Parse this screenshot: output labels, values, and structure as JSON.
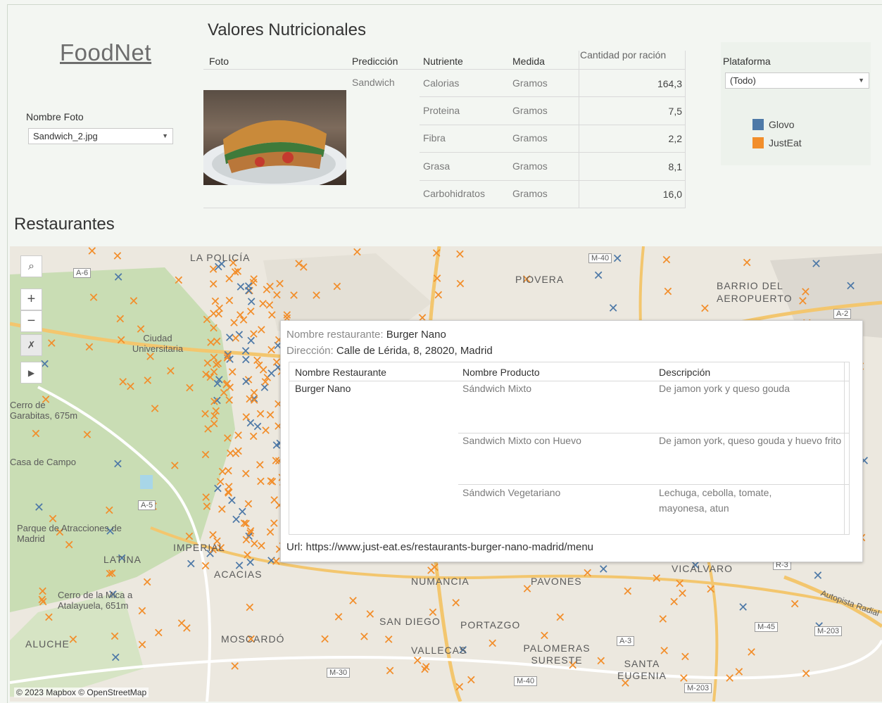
{
  "app": {
    "logo": "FoodNet"
  },
  "filters": {
    "photo_label": "Nombre Foto",
    "photo_value": "Sandwich_2.jpg",
    "platform_label": "Plataforma",
    "platform_value": "(Todo)"
  },
  "nutrition": {
    "title": "Valores Nutricionales",
    "headers": {
      "foto": "Foto",
      "prediccion": "Predicción",
      "nutriente": "Nutriente",
      "medida": "Medida",
      "cantidad": "Cantidad por ración"
    },
    "prediction": "Sandwich",
    "rows": [
      {
        "nutrient": "Calorias",
        "measure": "Gramos",
        "amount": "164,3"
      },
      {
        "nutrient": "Proteina",
        "measure": "Gramos",
        "amount": "7,5"
      },
      {
        "nutrient": "Fibra",
        "measure": "Gramos",
        "amount": "2,2"
      },
      {
        "nutrient": "Grasa",
        "measure": "Gramos",
        "amount": "8,1"
      },
      {
        "nutrient": "Carbohidratos",
        "measure": "Gramos",
        "amount": "16,0"
      }
    ]
  },
  "legend": {
    "items": [
      {
        "label": "Glovo",
        "color": "#4e79a7"
      },
      {
        "label": "JustEat",
        "color": "#f28e2b"
      }
    ]
  },
  "map": {
    "title": "Restaurantes",
    "attribution": "© 2023 Mapbox © OpenStreetMap",
    "labels": [
      "LA POLICÍA",
      "PIOVERA",
      "BARRIO DEL AEROPUERTO",
      "Ciudad Universitaria",
      "Cerro de Garabitas, 675m",
      "Casa de Campo",
      "Parque de Atracciones de Madrid",
      "LATINA",
      "IMPERIAL",
      "ACACIAS",
      "NUMANCIA",
      "PAVONES",
      "VICÁLVARO",
      "Cerro de la Mica a Atalayuela, 651m",
      "SAN DIEGO",
      "PORTAZGO",
      "ALUCHE",
      "MOSCARDÓ",
      "VALLECAS",
      "PALOMERAS SURESTE",
      "SANTA EUGENIA",
      "Autopista Radial"
    ],
    "roads": [
      "A-6",
      "M-40",
      "A-2",
      "A-5",
      "R-3",
      "M-45",
      "M-203",
      "A-3",
      "M-30",
      "M-40",
      "M-203"
    ]
  },
  "tooltip": {
    "name_key": "Nombre restaurante:",
    "name_val": "Burger Nano",
    "addr_key": "Dirección:",
    "addr_val": "Calle de Lérida, 8, 28020, Madrid",
    "headers": {
      "rest": "Nombre Restaurante",
      "prod": "Nombre Producto",
      "desc": "Descripción"
    },
    "restaurant": "Burger Nano",
    "rows": [
      {
        "product": "Sándwich Mixto",
        "desc": "De jamon york y queso gouda"
      },
      {
        "product": "Sandwich Mixto con Huevo",
        "desc": "De jamon york, queso gouda y huevo frito"
      },
      {
        "product": "Sándwich Vegetariano",
        "desc": "Lechuga, cebolla, tomate, mayonesa, atun"
      }
    ],
    "url_key": "Url:",
    "url_val": "https://www.just-eat.es/restaurants-burger-nano-madrid/menu"
  }
}
